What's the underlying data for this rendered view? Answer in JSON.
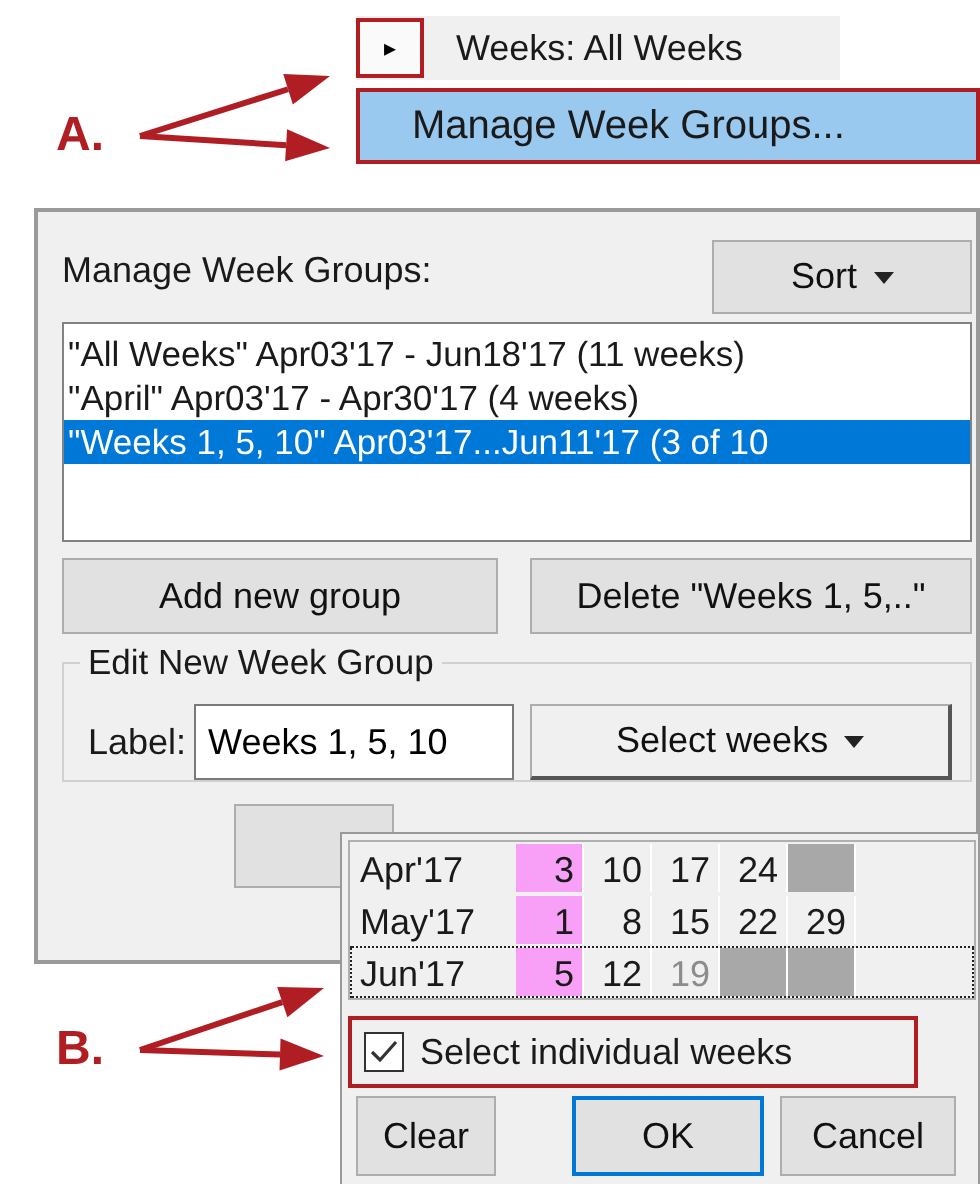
{
  "annotations": [
    {
      "label": "A."
    },
    {
      "label": "B."
    }
  ],
  "menu": {
    "expander": "▸",
    "title": "Weeks: All Weeks",
    "item": {
      "label": "Manage Week Groups...",
      "highlighted": true
    }
  },
  "panel": {
    "heading": "Manage Week Groups:",
    "sort_button": "Sort",
    "groups": [
      {
        "text": "\"All Weeks\" Apr03'17 - Jun18'17 (11 weeks)",
        "selected": false
      },
      {
        "text": "\"April\" Apr03'17 - Apr30'17 (4 weeks)",
        "selected": false
      },
      {
        "text": "\"Weeks 1, 5, 10\" Apr03'17...Jun11'17 (3 of 10",
        "selected": true
      }
    ],
    "add_button": "Add new group",
    "delete_button": "Delete \"Weeks 1, 5,..\"",
    "edit_group": {
      "title": "Edit New Week Group",
      "label_caption": "Label:",
      "label_value": "Weeks 1, 5, 10",
      "select_button": "Select weeks"
    }
  },
  "popup": {
    "months": [
      {
        "label": "Apr'17",
        "focused": false,
        "weeks": [
          {
            "kind": "day",
            "text": "3",
            "selected": true,
            "disabled": false
          },
          {
            "kind": "day",
            "text": "10",
            "selected": false,
            "disabled": false
          },
          {
            "kind": "day",
            "text": "17",
            "selected": false,
            "disabled": false
          },
          {
            "kind": "day",
            "text": "24",
            "selected": false,
            "disabled": false
          },
          {
            "kind": "blank"
          }
        ]
      },
      {
        "label": "May'17",
        "focused": false,
        "weeks": [
          {
            "kind": "day",
            "text": "1",
            "selected": true,
            "disabled": false
          },
          {
            "kind": "day",
            "text": "8",
            "selected": false,
            "disabled": false
          },
          {
            "kind": "day",
            "text": "15",
            "selected": false,
            "disabled": false
          },
          {
            "kind": "day",
            "text": "22",
            "selected": false,
            "disabled": false
          },
          {
            "kind": "day",
            "text": "29",
            "selected": false,
            "disabled": false
          }
        ]
      },
      {
        "label": "Jun'17",
        "focused": true,
        "weeks": [
          {
            "kind": "day",
            "text": "5",
            "selected": true,
            "disabled": false
          },
          {
            "kind": "day",
            "text": "12",
            "selected": false,
            "disabled": false
          },
          {
            "kind": "day",
            "text": "19",
            "selected": false,
            "disabled": true
          },
          {
            "kind": "blank"
          },
          {
            "kind": "blank"
          }
        ]
      }
    ],
    "checkbox": {
      "label": "Select individual weeks",
      "checked": true
    },
    "buttons": [
      {
        "label": "Clear",
        "default": false
      },
      {
        "label": "OK",
        "default": true
      },
      {
        "label": "Cancel",
        "default": false
      }
    ]
  }
}
